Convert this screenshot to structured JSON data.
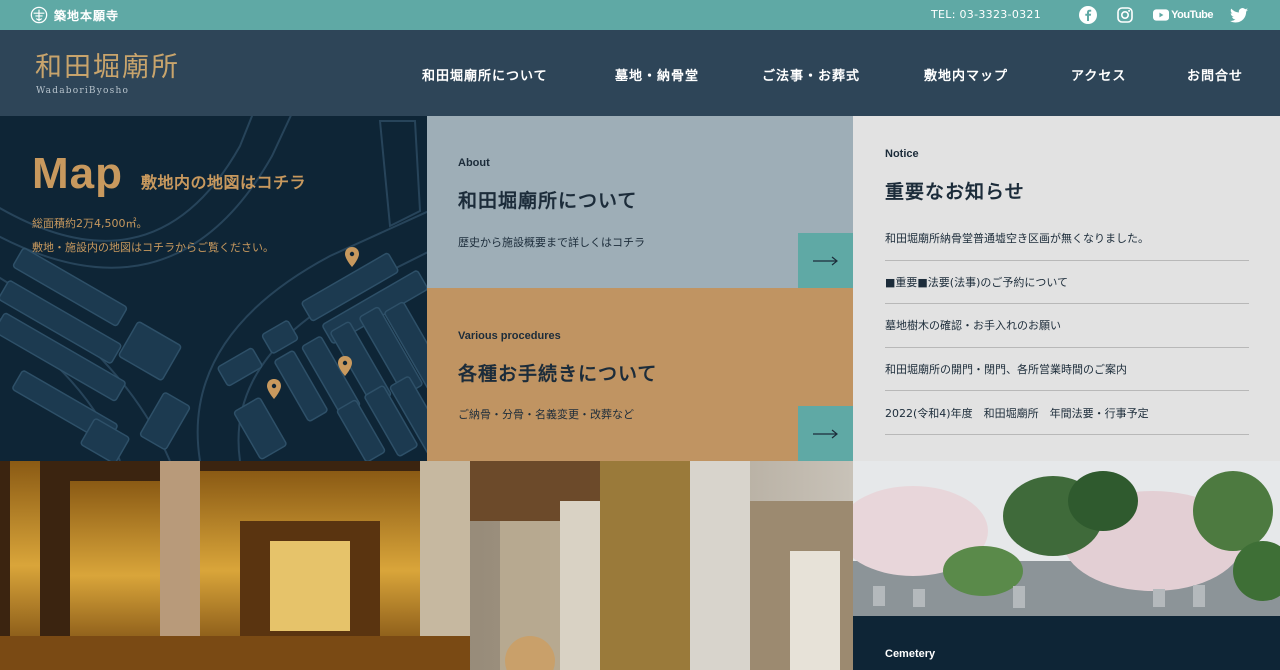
{
  "topbar": {
    "brand": "築地本願寺",
    "tel": "TEL: 03-3323-0321",
    "youtube_label": "YouTube",
    "icons": [
      "temple-logo-icon",
      "facebook-icon",
      "instagram-icon",
      "youtube-icon",
      "twitter-icon"
    ]
  },
  "header": {
    "logo_title": "和田堀廟所",
    "logo_sub": "WadaboriByosho",
    "nav": [
      {
        "label": "和田堀廟所について"
      },
      {
        "label": "墓地・納骨堂"
      },
      {
        "label": "ご法事・お葬式"
      },
      {
        "label": "敷地内マップ"
      },
      {
        "label": "アクセス"
      },
      {
        "label": "お問合せ"
      }
    ]
  },
  "map": {
    "title": "Map",
    "subtitle": "敷地内の地図はコチラ",
    "line1": "総面積約2万4,500㎡。",
    "line2": "敷地・施設内の地図はコチラからご覧ください。"
  },
  "about": {
    "label": "About",
    "heading": "和田堀廟所について",
    "desc": "歴史から施設概要まで詳しくはコチラ"
  },
  "procedures": {
    "label": "Various procedures",
    "heading": "各種お手続きについて",
    "desc": "ご納骨・分骨・名義変更・改葬など"
  },
  "notice": {
    "label": "Notice",
    "heading": "重要なお知らせ",
    "items": [
      "和田堀廟所納骨堂普通墟空き区画が無くなりました。",
      "■重要■法要(法事)のご予約について",
      "墓地樹木の確認・お手入れのお願い",
      "和田堀廟所の開門・閉門、各所営業時間のご案内",
      "2022(令和4)年度　和田堀廟所　年間法要・行事予定"
    ]
  },
  "cemetery": {
    "label": "Cemetery"
  },
  "colors": {
    "topbar": "#5fa9a5",
    "header": "#2e4558",
    "navy": "#0e2536",
    "gold": "#c8995e",
    "slate": "#9eaeb7",
    "tan": "#c09462",
    "notice_bg": "#e2e2e2"
  }
}
